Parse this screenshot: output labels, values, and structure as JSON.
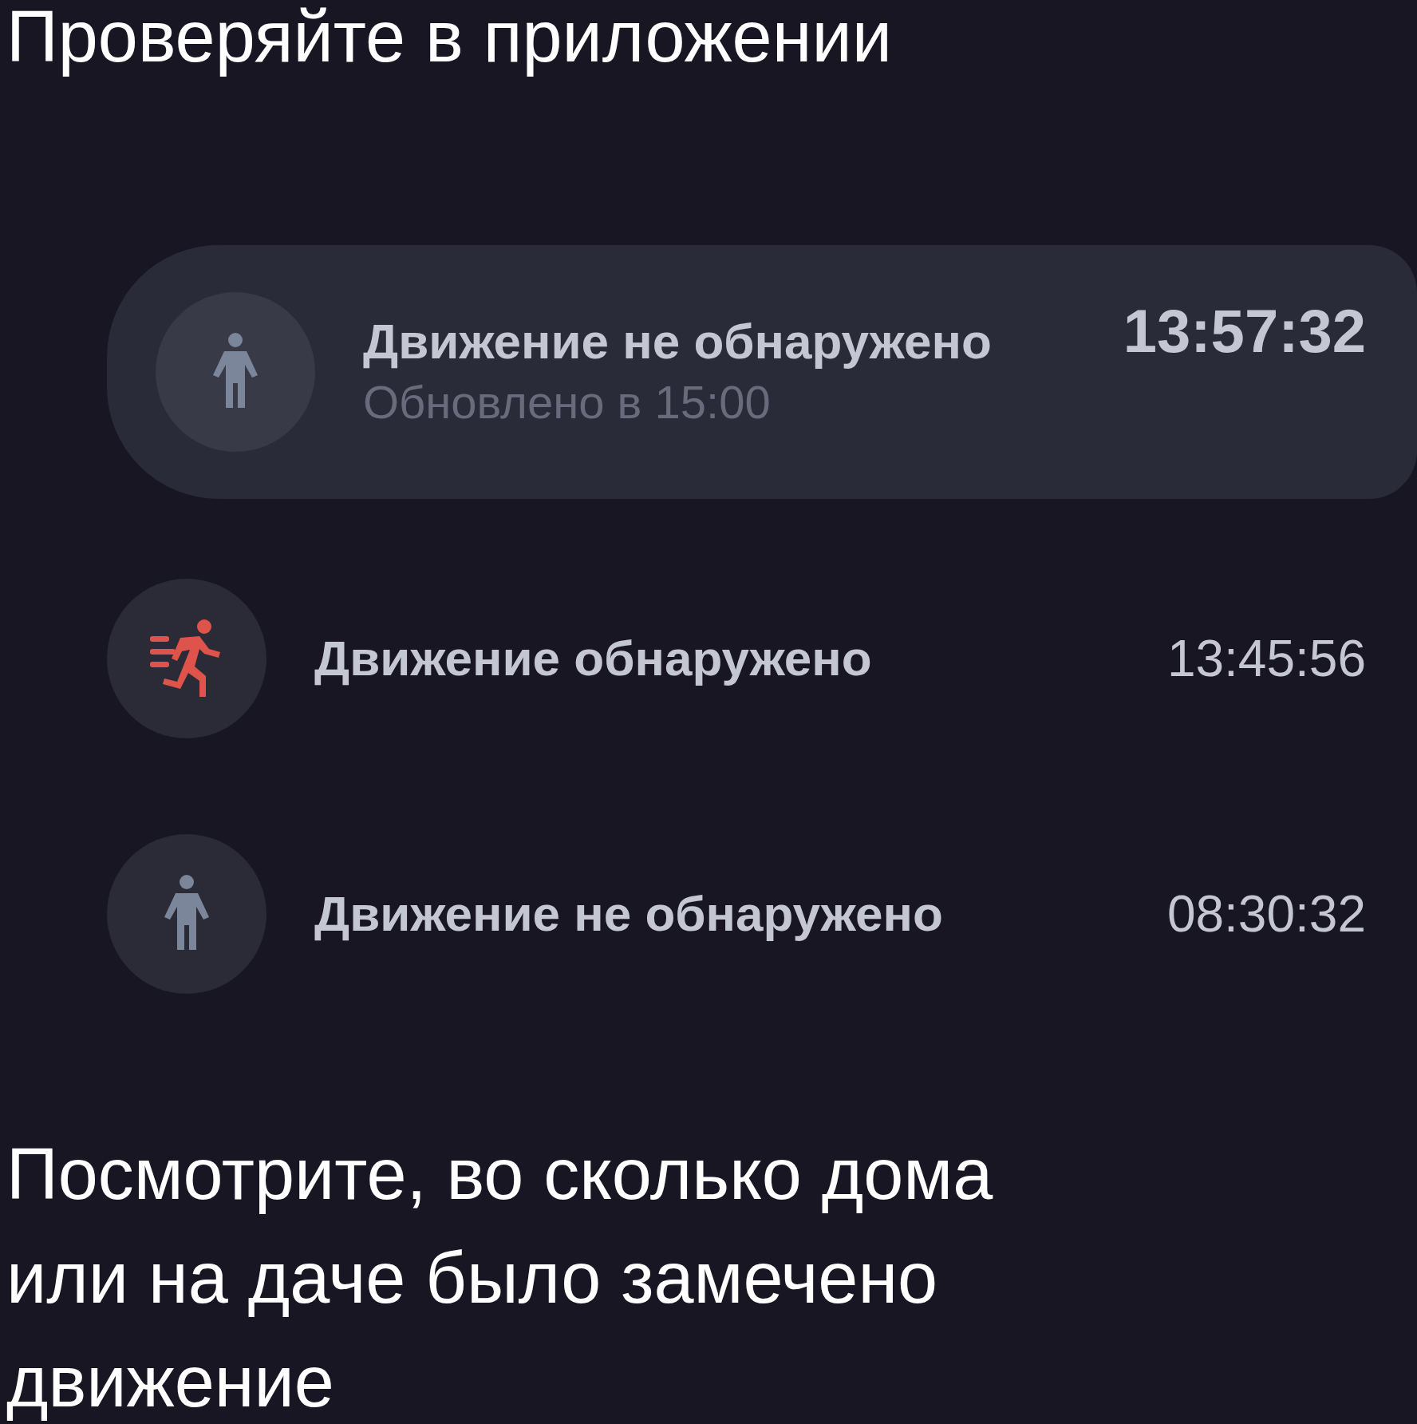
{
  "heading": "Проверяйте в приложении",
  "events": [
    {
      "title": "Движение не обнаружено",
      "subtitle": "Обновлено в 15:00",
      "time": "13:57:32",
      "motion": false,
      "selected": true
    },
    {
      "title": "Движение обнаружено",
      "time": "13:45:56",
      "motion": true,
      "selected": false
    },
    {
      "title": "Движение не обнаружено",
      "time": "08:30:32",
      "motion": false,
      "selected": false
    }
  ],
  "caption": "Посмотрите, во сколько дома или на даче было замечено движение"
}
